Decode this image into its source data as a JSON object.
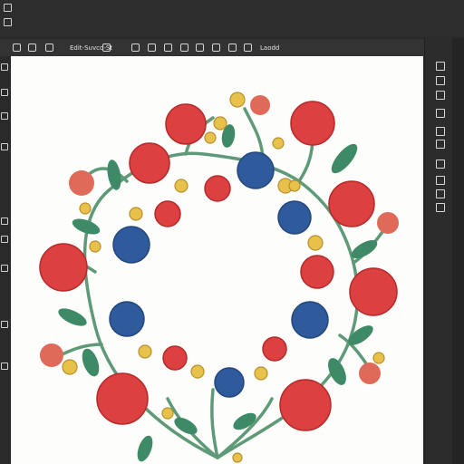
{
  "options_bar": {
    "menu_text": "Edit-Suvcd-St",
    "tool_text": "Laodd"
  },
  "colors": {
    "stem": "#5f9a78",
    "leaf": "#3f8a66",
    "red_flower": "#dc4040",
    "blue_flower": "#2f5a9c",
    "yellow_bud": "#e8c14b",
    "canvas": "#fdfdfb"
  }
}
